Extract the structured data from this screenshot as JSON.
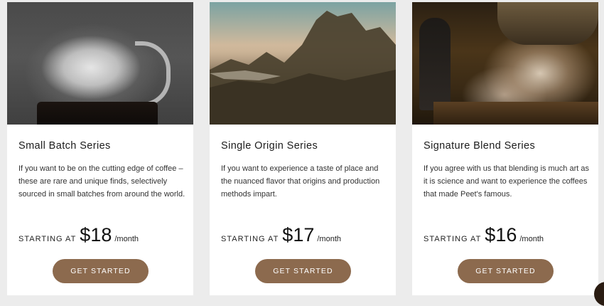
{
  "cards": [
    {
      "image": "glass-carafe-image",
      "title": "Small Batch Series",
      "description": "If you want to be on the cutting edge of coffee – these are rare and unique finds, selectively sourced in small batches from around the world.",
      "price_prefix": "STARTING AT",
      "price": "$18",
      "price_suffix": "/month",
      "button_label": "GET STARTED"
    },
    {
      "image": "mountain-landscape-image",
      "title": "Single Origin Series",
      "description": "If you want to experience a taste of place and the nuanced flavor that origins and production methods impart.",
      "price_prefix": "STARTING AT",
      "price": "$17",
      "price_suffix": "/month",
      "button_label": "GET STARTED"
    },
    {
      "image": "coffee-roaster-image",
      "title": "Signature Blend Series",
      "description": "If you agree with us that blending is much art as it is science and want to experience the coffees that made Peet's famous.",
      "price_prefix": "STARTING AT",
      "price": "$16",
      "price_suffix": "/month",
      "button_label": "GET STARTED"
    }
  ],
  "colors": {
    "page_background": "#ececec",
    "card_background": "#ffffff",
    "button_background": "#8c6a4e",
    "button_text": "#ffffff",
    "chat_bubble": "#2a1c12"
  },
  "icons": {
    "chat": "chat-bubble-icon"
  }
}
